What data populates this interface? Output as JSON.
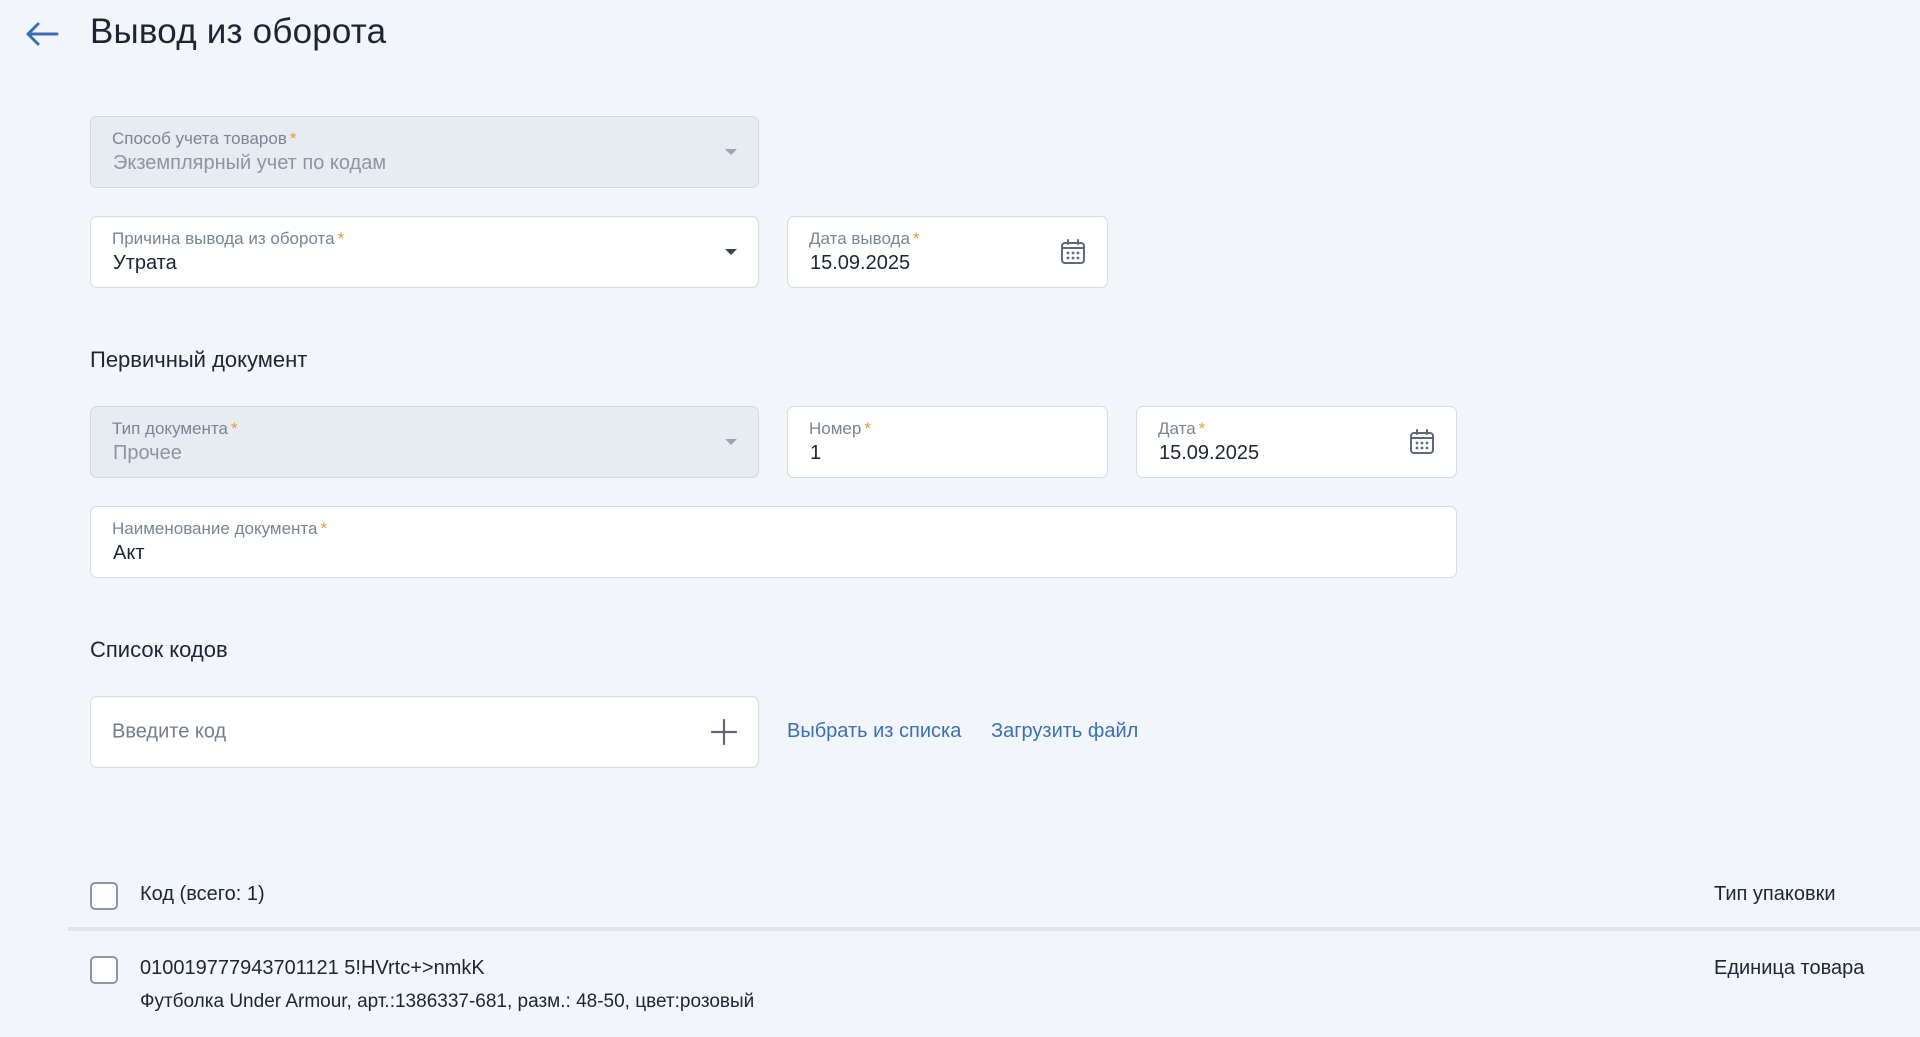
{
  "header": {
    "title": "Вывод из оборота"
  },
  "form": {
    "accounting_method": {
      "label": "Способ учета товаров",
      "value": "Экземплярный учет по кодам"
    },
    "reason": {
      "label": "Причина вывода из оборота",
      "value": "Утрата"
    },
    "withdrawal_date": {
      "label": "Дата вывода",
      "value": "15.09.2025"
    },
    "required_mark": "*"
  },
  "primary_document": {
    "title": "Первичный документ",
    "doc_type": {
      "label": "Тип документа",
      "value": "Прочее"
    },
    "number": {
      "label": "Номер",
      "value": "1"
    },
    "date": {
      "label": "Дата",
      "value": "15.09.2025"
    },
    "doc_name": {
      "label": "Наименование документа",
      "value": "Акт"
    }
  },
  "codes": {
    "title": "Список кодов",
    "input_placeholder": "Введите код",
    "select_from_list": "Выбрать из списка",
    "upload_file": "Загрузить файл"
  },
  "table": {
    "header_code": "Код (всего: 1)",
    "header_pack": "Тип упаковки",
    "rows": [
      {
        "code": "010019777943701121 5!HVrtc+>nmkK",
        "description": "Футболка Under Armour, арт.:1386337-681, разм.: 48-50, цвет:розовый",
        "pack_type": "Единица товара"
      }
    ]
  },
  "icons": {
    "back": "arrow-left-icon",
    "dropdown": "caret-down-icon",
    "calendar": "calendar-icon",
    "add": "plus-icon"
  },
  "colors": {
    "background": "#f2f5f9",
    "accent": "#3b6eb8",
    "required": "#e59a3c"
  }
}
